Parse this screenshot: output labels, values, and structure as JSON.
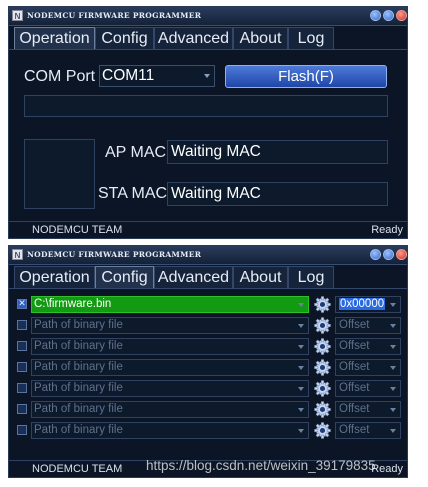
{
  "app": {
    "title": "NODEMCU FIRMWARE PROGRAMMER",
    "icon_letter": "N",
    "brand_color": "#0b1525",
    "accent_color": "#2d5ec8"
  },
  "tabs": [
    "Operation",
    "Config",
    "Advanced",
    "About",
    "Log"
  ],
  "operation": {
    "com_port_label": "COM Port",
    "com_port_value": "COM11",
    "flash_label": "Flash(F)",
    "progress_text": "",
    "ap_mac_label": "AP MAC",
    "ap_mac_value": "Waiting MAC",
    "sta_mac_label": "STA MAC",
    "sta_mac_value": "Waiting MAC"
  },
  "config": {
    "rows": [
      {
        "checked": true,
        "path": "C:\\firmware.bin",
        "offset": "0x00000"
      },
      {
        "checked": false,
        "path": "Path of binary file",
        "offset": "Offset"
      },
      {
        "checked": false,
        "path": "Path of binary file",
        "offset": "Offset"
      },
      {
        "checked": false,
        "path": "Path of binary file",
        "offset": "Offset"
      },
      {
        "checked": false,
        "path": "Path of binary file",
        "offset": "Offset"
      },
      {
        "checked": false,
        "path": "Path of binary file",
        "offset": "Offset"
      },
      {
        "checked": false,
        "path": "Path of binary file",
        "offset": "Offset"
      }
    ],
    "checkbox_mark": "✕"
  },
  "status": {
    "team": "NODEMCU TEAM",
    "state": "Ready"
  },
  "watermark": "https://blog.csdn.net/weixin_39179835"
}
